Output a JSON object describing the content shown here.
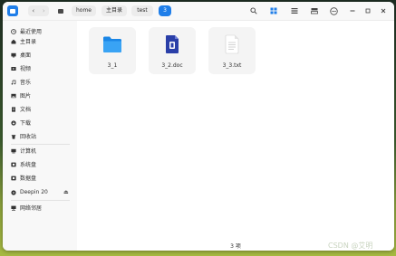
{
  "breadcrumbs": [
    "home",
    "主目录",
    "test",
    "3"
  ],
  "sidebar": {
    "items": [
      {
        "label": "最近使用",
        "icon": "clock-icon"
      },
      {
        "label": "主目录",
        "icon": "home-icon"
      },
      {
        "label": "桌面",
        "icon": "desktop-icon"
      },
      {
        "label": "视频",
        "icon": "video-icon"
      },
      {
        "label": "音乐",
        "icon": "music-icon"
      },
      {
        "label": "图片",
        "icon": "picture-icon"
      },
      {
        "label": "文档",
        "icon": "document-icon"
      },
      {
        "label": "下载",
        "icon": "download-icon"
      },
      {
        "label": "回收站",
        "icon": "trash-icon"
      }
    ],
    "devices": [
      {
        "label": "计算机",
        "icon": "computer-icon"
      },
      {
        "label": "系统盘",
        "icon": "disk-icon"
      },
      {
        "label": "数据盘",
        "icon": "disk-icon"
      },
      {
        "label": "Deepin 20",
        "icon": "disc-icon"
      }
    ],
    "network": {
      "label": "网络邻居",
      "icon": "network-icon"
    }
  },
  "files": [
    {
      "name": "3_1",
      "icon": "folder-icon"
    },
    {
      "name": "3_2.doc",
      "icon": "word-document-icon"
    },
    {
      "name": "3_3.txt",
      "icon": "text-file-icon"
    }
  ],
  "status": {
    "count_text": "3 项"
  },
  "watermark": {
    "text": "CSDN @艾明"
  },
  "colors": {
    "accent": "#1f7ee9",
    "sidebar_bg": "#f8f8f8",
    "tile_bg": "#f4f4f4"
  }
}
